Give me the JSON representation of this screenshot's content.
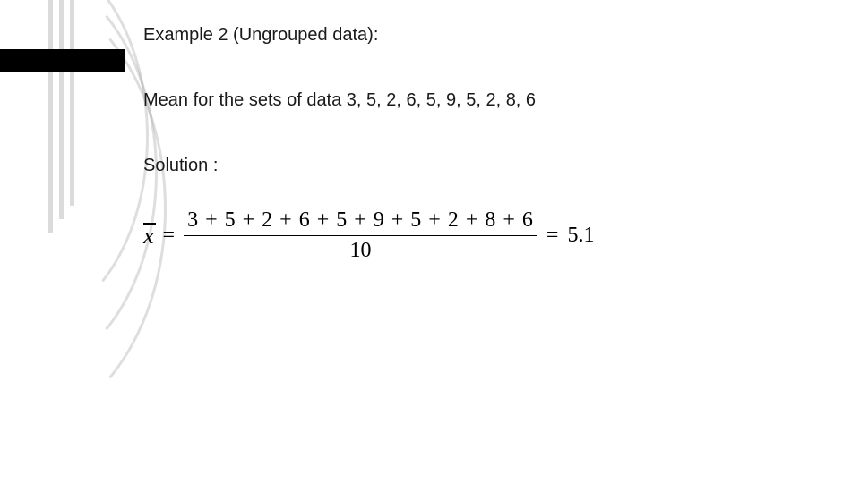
{
  "title": "Example 2 (Ungrouped data):",
  "problem": "Mean for the sets of data 3, 5, 2, 6, 5, 9, 5, 2, 8, 6",
  "solution_label": "Solution :",
  "formula": {
    "lhs_symbol_char": "x",
    "equals": "=",
    "numerator": "3 + 5 + 2 + 6 + 5 + 9 + 5 + 2 + 8 + 6",
    "denominator": "10",
    "equals2": "=",
    "result": "5.1"
  }
}
